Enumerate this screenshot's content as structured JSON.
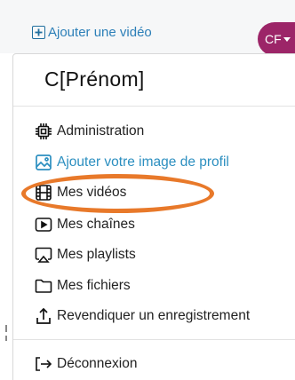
{
  "header": {
    "add_video_label": "Ajouter une vidéo",
    "avatar_initials": "CF",
    "avatar_color": "#9c2568",
    "accent_color": "#2c7fb8"
  },
  "menu": {
    "user_name": "C[Prénom]",
    "items": [
      {
        "label": "Administration",
        "icon": "chip-icon"
      },
      {
        "label": "Ajouter votre image de profil",
        "icon": "image-icon"
      },
      {
        "label": "Mes vidéos",
        "icon": "film-icon"
      },
      {
        "label": "Mes chaînes",
        "icon": "play-box-icon"
      },
      {
        "label": "Mes playlists",
        "icon": "airplay-icon"
      },
      {
        "label": "Mes fichiers",
        "icon": "folder-icon"
      },
      {
        "label": "Revendiquer un enregistrement",
        "icon": "upload-icon"
      },
      {
        "label": "Déconnexion",
        "icon": "logout-icon"
      }
    ]
  },
  "annotation": {
    "highlight_color": "#e8792a",
    "highlighted_item": "Mes vidéos"
  }
}
